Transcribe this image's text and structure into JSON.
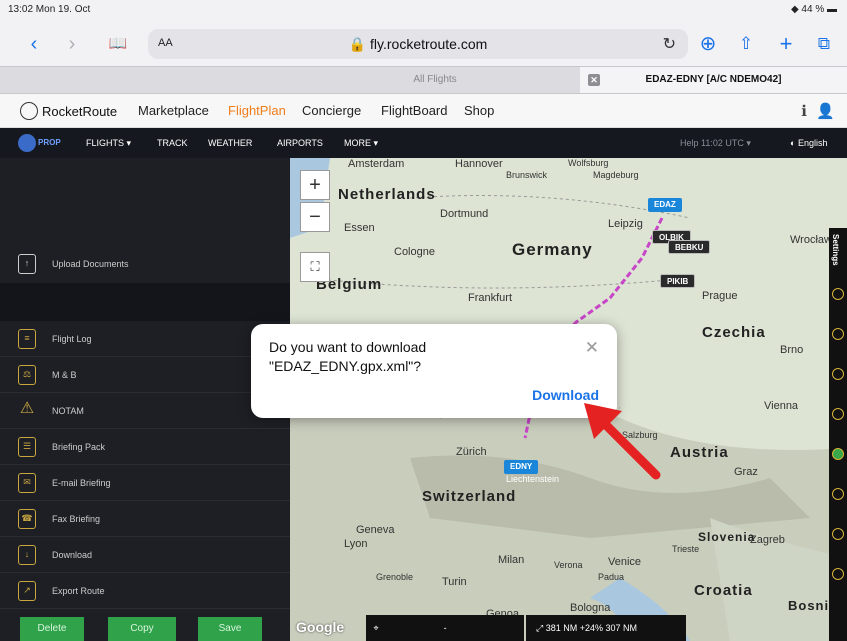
{
  "status": {
    "time": "13:02  Mon 19. Oct",
    "battery": "44 %"
  },
  "browser": {
    "aa": "AA",
    "url": "fly.rocketroute.com",
    "tabs": [
      "All Flights",
      "EDAZ-EDNY [A/C NDEMO42]"
    ]
  },
  "site": {
    "brand": "RocketRoute",
    "nav": [
      "Marketplace",
      "FlightPlan",
      "Concierge",
      "FlightBoard",
      "Shop"
    ]
  },
  "appbar": {
    "prop": "PROP",
    "items": [
      "FLIGHTS ▾",
      "TRACK",
      "WEATHER",
      "AIRPORTS",
      "MORE ▾"
    ],
    "help": "Help  11:02  UTC ▾",
    "lang": "English"
  },
  "sidebar": {
    "upload": "Upload Documents",
    "items": [
      "Flight Log",
      "M & B",
      "NOTAM",
      "Briefing Pack",
      "E-mail Briefing",
      "Fax Briefing",
      "Download",
      "Export Route"
    ],
    "buttons": [
      "Delete",
      "Copy",
      "Save"
    ]
  },
  "map": {
    "countries": [
      "Netherlands",
      "Germany",
      "Belgium",
      "Czechia",
      "Austria",
      "Switzerland",
      "Slovenia",
      "Croatia",
      "Liechtenstein"
    ],
    "cities": [
      "Amsterdam",
      "Hannover",
      "Wolfsburg",
      "Brunswick",
      "Magdeburg",
      "Dortmund",
      "Essen",
      "Cologne",
      "Frankfurt",
      "Leipzig",
      "Wrocław",
      "Prague",
      "Brno",
      "Vienna",
      "Salzburg",
      "Graz",
      "Zürich",
      "Geneva",
      "Lyon",
      "Milan",
      "Verona",
      "Venice",
      "Padua",
      "Turin",
      "Trieste",
      "Zagreb",
      "Bologna",
      "Grenoble",
      "Genoa",
      "Bosnia and Herzegovina"
    ],
    "waypoints": [
      "EDAZ",
      "OLBIK",
      "BEBKU",
      "PIKIB",
      "EDNY"
    ],
    "settings": "Settings",
    "distance": "381 NM +24%  307 NM",
    "google": "Google"
  },
  "dialog": {
    "line1": "Do you want to download",
    "line2": "\"EDAZ_EDNY.gpx.xml\"?",
    "action": "Download"
  }
}
